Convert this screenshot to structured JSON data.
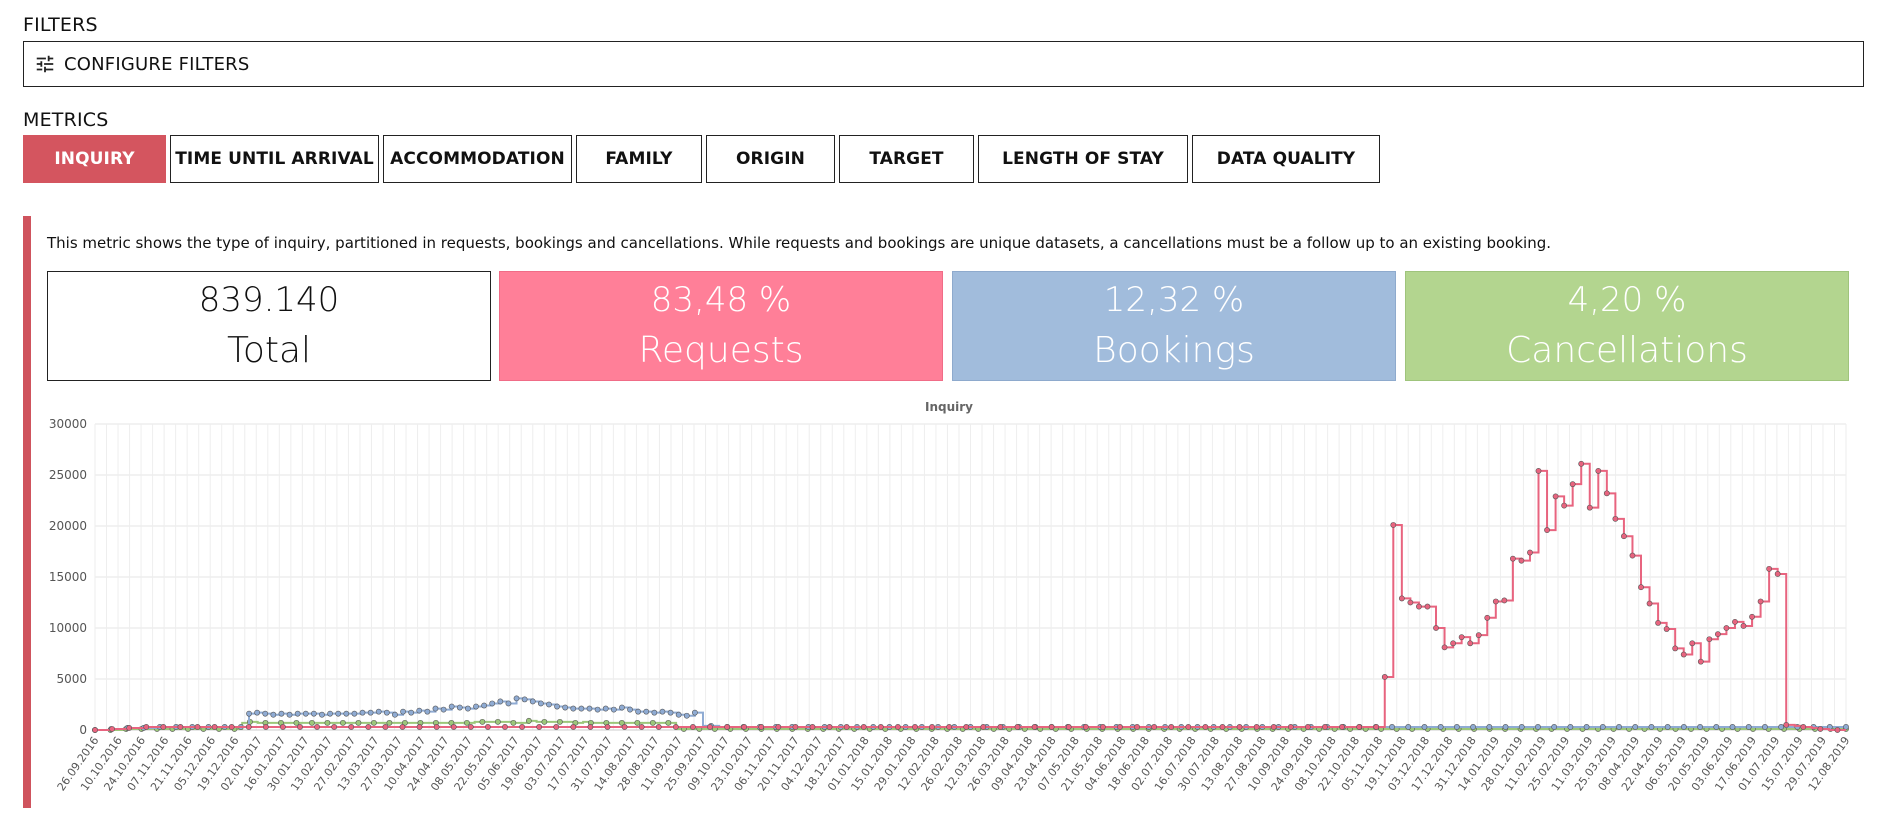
{
  "filters": {
    "section_label": "FILTERS",
    "configure_label": "CONFIGURE FILTERS",
    "icon": "tune-icon"
  },
  "metrics": {
    "section_label": "METRICS",
    "tabs": [
      {
        "label": "INQUIRY",
        "active": true
      },
      {
        "label": "TIME UNTIL ARRIVAL",
        "active": false
      },
      {
        "label": "ACCOMMODATION",
        "active": false
      },
      {
        "label": "FAMILY",
        "active": false
      },
      {
        "label": "ORIGIN",
        "active": false
      },
      {
        "label": "TARGET",
        "active": false
      },
      {
        "label": "LENGTH OF STAY",
        "active": false
      },
      {
        "label": "DATA QUALITY",
        "active": false
      }
    ]
  },
  "panel": {
    "description": "This metric shows the type of inquiry, partitioned in requests, bookings and cancellations. While requests and bookings are unique datasets, a cancellations must be a follow up to an existing booking.",
    "cards": {
      "total": {
        "value": "839.140",
        "label": "Total"
      },
      "requests": {
        "value": "83,48 %",
        "label": "Requests"
      },
      "bookings": {
        "value": "12,32 %",
        "label": "Bookings"
      },
      "cancellations": {
        "value": "4,20 %",
        "label": "Cancellations"
      }
    }
  },
  "colors": {
    "accent": "#d4555f",
    "requests": "#ff7f98",
    "bookings": "#a1bcdc",
    "cancellations": "#b3d58f",
    "requests_line": "#e8647f",
    "bookings_line": "#8fabd3",
    "cancellations_line": "#9cc77a"
  },
  "chart_data": {
    "type": "line",
    "title": "Inquiry",
    "step": true,
    "grid": true,
    "ylim": [
      0,
      30000
    ],
    "yticks": [
      0,
      5000,
      10000,
      15000,
      20000,
      25000,
      30000
    ],
    "x_tick_labels": [
      "26.09.2016",
      "10.10.2016",
      "24.10.2016",
      "07.11.2016",
      "21.11.2016",
      "05.12.2016",
      "19.12.2016",
      "02.01.2017",
      "16.01.2017",
      "30.01.2017",
      "13.02.2017",
      "27.02.2017",
      "13.03.2017",
      "27.03.2017",
      "10.04.2017",
      "24.04.2017",
      "08.05.2017",
      "22.05.2017",
      "05.06.2017",
      "19.06.2017",
      "03.07.2017",
      "17.07.2017",
      "31.07.2017",
      "14.08.2017",
      "28.08.2017",
      "11.09.2017",
      "25.09.2017",
      "09.10.2017",
      "23.10.2017",
      "06.11.2017",
      "20.11.2017",
      "04.12.2017",
      "18.12.2017",
      "01.01.2018",
      "15.01.2018",
      "29.01.2018",
      "12.02.2018",
      "26.02.2018",
      "12.03.2018",
      "26.03.2018",
      "09.04.2018",
      "23.04.2018",
      "07.05.2018",
      "21.05.2018",
      "04.06.2018",
      "18.06.2018",
      "02.07.2018",
      "16.07.2018",
      "30.07.2018",
      "13.08.2018",
      "27.08.2018",
      "10.09.2018",
      "24.09.2018",
      "08.10.2018",
      "22.10.2018",
      "05.11.2018",
      "19.11.2018",
      "03.12.2018",
      "17.12.2018",
      "31.12.2018",
      "14.01.2019",
      "28.01.2019",
      "11.02.2019",
      "25.02.2019",
      "11.03.2019",
      "25.03.2019",
      "08.04.2019",
      "22.04.2019",
      "06.05.2019",
      "20.05.2019",
      "03.06.2019",
      "17.06.2019",
      "01.07.2019",
      "15.07.2019",
      "29.07.2019",
      "12.08.2019"
    ],
    "series": [
      {
        "key": "requests",
        "color": "#e8647f",
        "values": [
          0,
          0,
          100,
          100,
          200,
          200,
          300,
          300,
          300,
          300,
          300,
          300,
          300,
          300,
          300,
          300,
          300,
          300,
          300,
          300,
          300,
          300,
          300,
          300,
          300,
          300,
          300,
          300,
          300,
          300,
          300,
          300,
          300,
          300,
          300,
          300,
          300,
          300,
          300,
          300,
          300,
          300,
          300,
          300,
          300,
          300,
          300,
          300,
          300,
          300,
          300,
          300,
          300,
          300,
          300,
          300,
          300,
          300,
          300,
          300,
          300,
          300,
          300,
          300,
          300,
          300,
          300,
          300,
          300,
          300,
          300,
          300,
          300,
          300,
          300,
          300,
          300,
          300,
          300,
          300,
          300,
          300,
          300,
          300,
          300,
          300,
          300,
          300,
          300,
          300,
          300,
          300,
          300,
          300,
          300,
          300,
          300,
          300,
          300,
          300,
          300,
          300,
          300,
          300,
          300,
          300,
          300,
          300,
          300,
          300,
          300,
          300,
          300,
          300,
          300,
          300,
          300,
          300,
          300,
          300,
          300,
          300,
          300,
          300,
          300,
          300,
          300,
          300,
          300,
          300,
          300,
          300,
          300,
          300,
          300,
          300,
          300,
          300,
          300,
          300,
          300,
          300,
          300,
          300,
          300,
          300,
          300,
          300,
          300,
          300,
          300,
          5200,
          20100,
          12900,
          12500,
          12100,
          12100,
          10000,
          8100,
          8500,
          9100,
          8500,
          9300,
          11000,
          12600,
          12700,
          16800,
          16600,
          17400,
          25400,
          19600,
          22900,
          22000,
          24100,
          26100,
          21800,
          25400,
          23200,
          20700,
          19000,
          17100,
          14000,
          12400,
          10500,
          9900,
          8000,
          7400,
          8500,
          6700,
          8900,
          9400,
          10000,
          10600,
          10200,
          11100,
          12600,
          15800,
          15300,
          500,
          400,
          300,
          200,
          100,
          0,
          0,
          0
        ]
      },
      {
        "key": "bookings",
        "color": "#8fabd3",
        "values": [
          0,
          0,
          100,
          100,
          200,
          200,
          200,
          200,
          300,
          300,
          300,
          300,
          300,
          300,
          300,
          300,
          300,
          300,
          300,
          1600,
          1700,
          1600,
          1500,
          1600,
          1500,
          1600,
          1600,
          1600,
          1500,
          1600,
          1600,
          1600,
          1600,
          1700,
          1700,
          1800,
          1700,
          1500,
          1800,
          1700,
          1900,
          1800,
          2100,
          2000,
          2300,
          2200,
          2100,
          2300,
          2400,
          2600,
          2800,
          2600,
          3100,
          3000,
          2800,
          2600,
          2500,
          2300,
          2200,
          2100,
          2100,
          2100,
          2000,
          2100,
          2000,
          2200,
          2000,
          1800,
          1800,
          1700,
          1800,
          1700,
          1500,
          1400,
          1700,
          400,
          400,
          300,
          300,
          300,
          300,
          300,
          300,
          300,
          300,
          300,
          300,
          300,
          300,
          300,
          300,
          300,
          300,
          300,
          300,
          300,
          300,
          300,
          300,
          300,
          300,
          300,
          300,
          300,
          300,
          300,
          300,
          300,
          300,
          300,
          300,
          300,
          300,
          300,
          300,
          300,
          300,
          300,
          300,
          300,
          300,
          300,
          300,
          300,
          300,
          300,
          300,
          300,
          300,
          300,
          300,
          300,
          300,
          300,
          300,
          300,
          300,
          300,
          300,
          300,
          300,
          300,
          300,
          300,
          300,
          300,
          300,
          300,
          300,
          300,
          300,
          300,
          300,
          300,
          300,
          300,
          300,
          300,
          300,
          300,
          300,
          300,
          300,
          300,
          300,
          300,
          300,
          300,
          300,
          300,
          300,
          300,
          300,
          300,
          300,
          300,
          300,
          300,
          300,
          300,
          300,
          300,
          300,
          300,
          300,
          300,
          300,
          300,
          300,
          300,
          300,
          300,
          300,
          300,
          300,
          300,
          300,
          300,
          300,
          300,
          300,
          300,
          300,
          300,
          300,
          300,
          300,
          300,
          300,
          300,
          300,
          300,
          300,
          300,
          300,
          300,
          300
        ]
      },
      {
        "key": "cancellations",
        "color": "#9cc77a",
        "values": [
          0,
          0,
          0,
          0,
          100,
          100,
          100,
          100,
          100,
          100,
          100,
          100,
          100,
          100,
          100,
          100,
          100,
          100,
          100,
          700,
          800,
          700,
          700,
          700,
          700,
          700,
          700,
          700,
          700,
          700,
          700,
          700,
          700,
          700,
          700,
          700,
          700,
          700,
          700,
          700,
          700,
          700,
          700,
          700,
          700,
          700,
          700,
          700,
          700,
          800,
          800,
          800,
          800,
          800,
          700,
          700,
          900,
          800,
          800,
          800,
          800,
          800,
          700,
          800,
          700,
          700,
          700,
          700,
          700,
          700,
          700,
          700,
          700,
          700,
          700,
          100,
          100,
          100,
          100,
          100,
          100,
          100,
          100,
          100,
          100,
          100,
          100,
          100,
          100,
          100,
          100,
          100,
          100,
          100,
          100,
          100,
          100,
          100,
          100,
          100,
          100,
          100,
          100,
          100,
          100,
          100,
          100,
          100,
          100,
          100,
          100,
          100,
          100,
          100,
          100,
          100,
          100,
          100,
          100,
          100,
          100,
          100,
          100,
          100,
          100,
          100,
          100,
          100,
          100,
          100,
          100,
          100,
          100,
          100,
          100,
          100,
          100,
          100,
          100,
          100,
          100,
          100,
          100,
          100,
          100,
          100,
          100,
          100,
          100,
          100,
          100,
          100,
          100,
          100,
          100,
          100,
          100,
          100,
          100,
          100,
          100,
          100,
          100,
          100,
          100,
          100,
          100,
          100,
          100,
          100,
          100,
          100,
          100,
          100,
          100,
          100,
          100,
          100,
          100,
          100,
          100,
          100,
          100,
          100,
          100,
          100,
          100,
          100,
          100,
          100,
          100,
          100,
          100,
          100,
          100,
          100,
          100,
          100,
          100,
          100,
          100,
          100,
          100,
          100,
          100,
          100,
          100,
          100,
          100,
          100,
          100,
          100,
          100,
          100,
          100,
          100,
          100,
          100,
          100,
          100,
          100,
          100,
          100,
          100,
          100,
          100,
          100
        ]
      }
    ]
  }
}
